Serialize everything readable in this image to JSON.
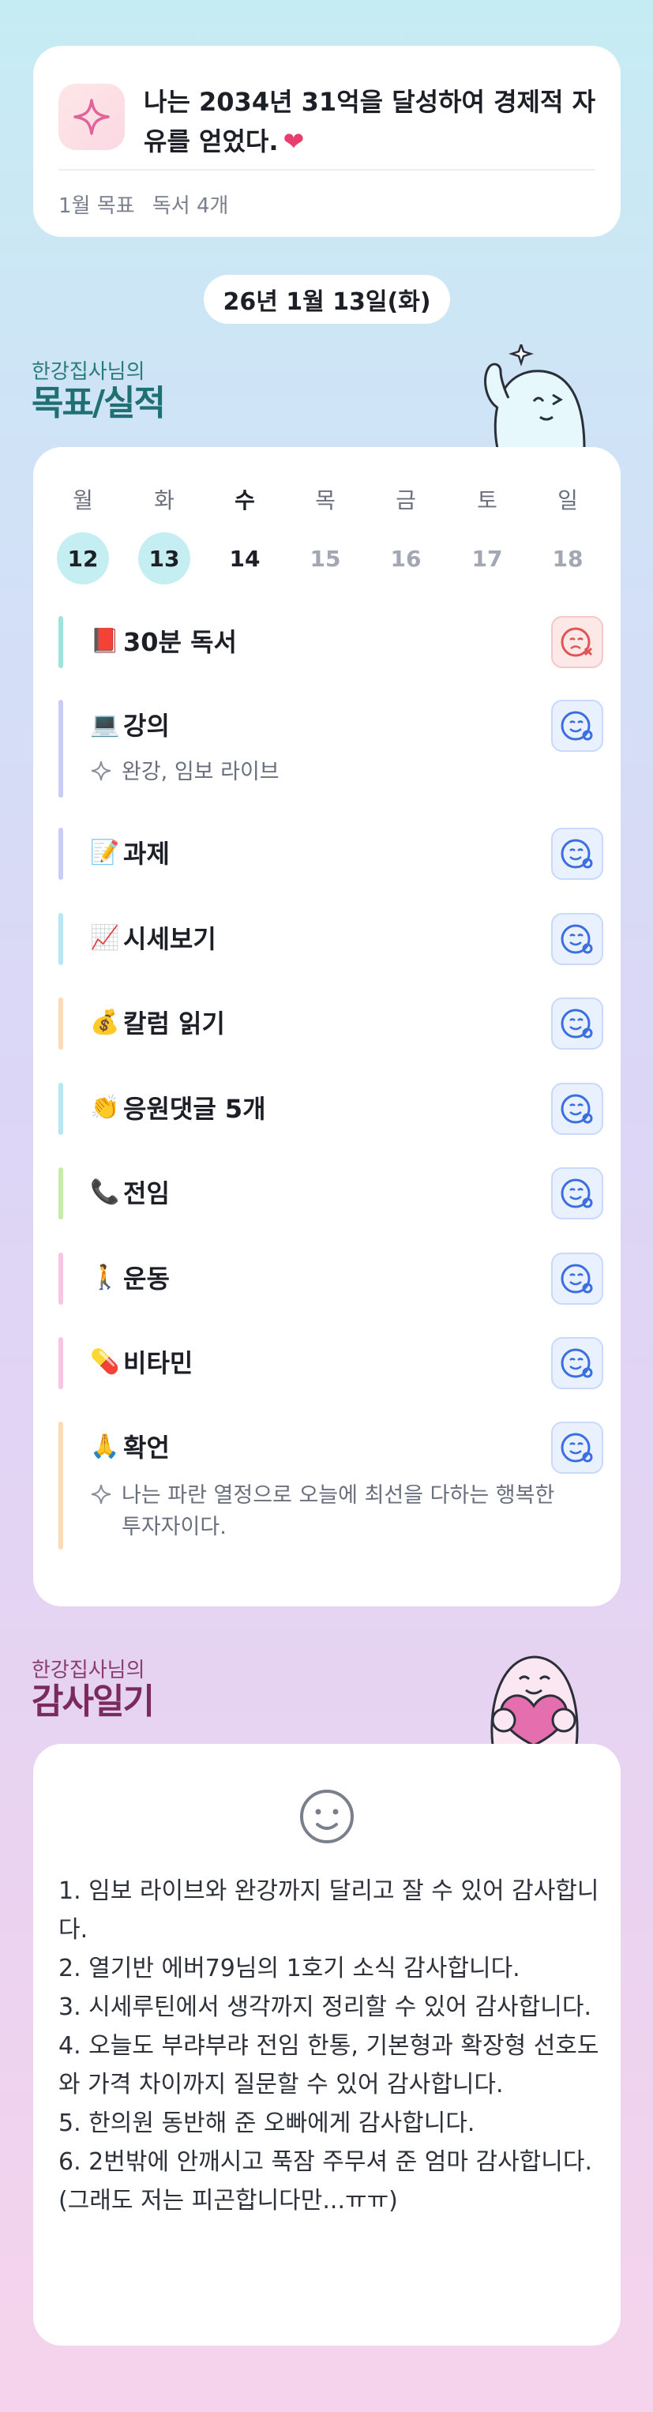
{
  "goal": {
    "title": "나는 2034년 31억을 달성하여 경제적 자유를 얻었다.",
    "heart": "❤",
    "month_goal_label": "1월 목표",
    "month_goal_value": "독서 4개"
  },
  "date": "26년 1월 13일(화)",
  "schedule_section": {
    "small": "한강집사님의",
    "big": "목표/실적"
  },
  "week": [
    {
      "name": "월",
      "num": "12",
      "state": "done"
    },
    {
      "name": "화",
      "num": "13",
      "state": "done"
    },
    {
      "name": "수",
      "num": "14",
      "state": "today"
    },
    {
      "name": "목",
      "num": "15",
      "state": "future"
    },
    {
      "name": "금",
      "num": "16",
      "state": "future"
    },
    {
      "name": "토",
      "num": "17",
      "state": "future"
    },
    {
      "name": "일",
      "num": "18",
      "state": "future"
    }
  ],
  "tasks": [
    {
      "emoji": "📕",
      "label": "30분 독서",
      "status": "fail",
      "color": "#9fe3dc",
      "note": ""
    },
    {
      "emoji": "💻",
      "label": "강의",
      "status": "ok",
      "color": "#c9cdf6",
      "note": "완강, 임보 라이브"
    },
    {
      "emoji": "📝",
      "label": "과제",
      "status": "ok",
      "color": "#c9cdf6",
      "note": ""
    },
    {
      "emoji": "📈",
      "label": "시세보기",
      "status": "ok",
      "color": "#b5e8f2",
      "note": ""
    },
    {
      "emoji": "💰",
      "label": "칼럼 읽기",
      "status": "ok",
      "color": "#fbdcb5",
      "note": ""
    },
    {
      "emoji": "👏",
      "label": "응원댓글 5개",
      "status": "ok",
      "color": "#b5e8f2",
      "note": ""
    },
    {
      "emoji": "📞",
      "label": "전임",
      "status": "ok",
      "color": "#c9eba8",
      "note": ""
    },
    {
      "emoji": "🚶",
      "label": "운동",
      "status": "ok",
      "color": "#f8c6e3",
      "note": ""
    },
    {
      "emoji": "💊",
      "label": "비타민",
      "status": "ok",
      "color": "#f8c6e3",
      "note": ""
    },
    {
      "emoji": "🙏",
      "label": "확언",
      "status": "ok",
      "color": "#fbdcb5",
      "note": "나는 파란 열정으로 오늘에 최선을 다하는 행복한 투자자이다."
    }
  ],
  "diary_section": {
    "small": "한강집사님의",
    "big": "감사일기"
  },
  "diary": [
    "1. 임보 라이브와 완강까지 달리고 잘 수 있어 감사합니다.",
    "2. 열기반 에버79님의 1호기 소식 감사합니다.",
    "3. 시세루틴에서 생각까지 정리할 수 있어 감사합니다.",
    "4. 오늘도 부랴부랴 전임 한통, 기본형과 확장형 선호도와 가격 차이까지 질문할 수 있어 감사합니다.",
    "5. 한의원 동반해 준 오빠에게 감사합니다.",
    "6. 2번밖에 안깨시고 푹잠 주무셔 준 엄마 감사합니다.(그래도 저는 피곤합니다만...ㅠㅠ)"
  ],
  "colors": {
    "accent": "#1f6f73",
    "status_ok": "#3b6fe0",
    "status_fail": "#e05555"
  }
}
